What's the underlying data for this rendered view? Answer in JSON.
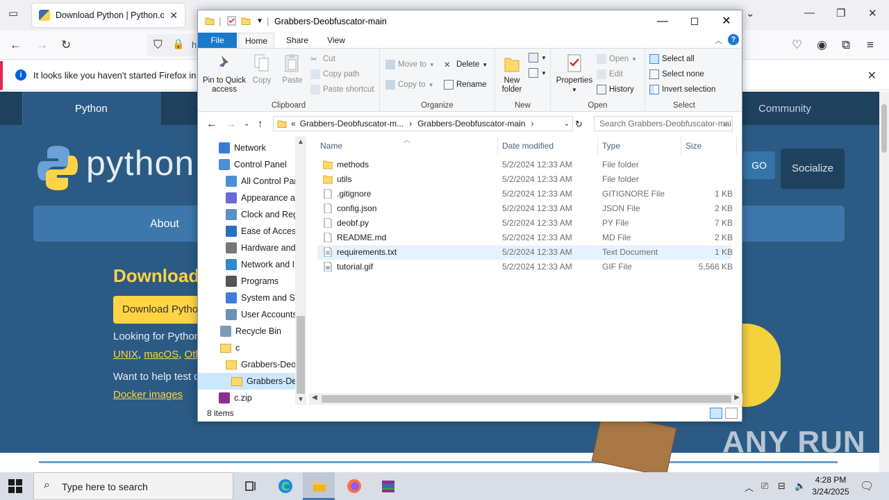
{
  "browser": {
    "tab_title": "Download Python | Python.org",
    "url_prefix": "h",
    "notice": "It looks like you haven't started Firefox in a while"
  },
  "website": {
    "nav": [
      "Python",
      "Community"
    ],
    "wordmark": "python",
    "go": "GO",
    "socialize": "Socialize",
    "menu_about": "About",
    "heading": "Download",
    "download_button": "Download Python",
    "looking_for": "Looking for Python",
    "os_links": [
      "UNIX",
      "macOS",
      "Other"
    ],
    "want_help": "Want to help test development",
    "docker": "Docker images",
    "watermark": "ANY RUN"
  },
  "explorer": {
    "title": "Grabbers-Deobfuscator-main",
    "tabs": {
      "file": "File",
      "home": "Home",
      "share": "Share",
      "view": "View"
    },
    "ribbon": {
      "clipboard": {
        "label": "Clipboard",
        "pin": "Pin to Quick access",
        "copy": "Copy",
        "paste": "Paste",
        "cut": "Cut",
        "copy_path": "Copy path",
        "paste_shortcut": "Paste shortcut"
      },
      "organize": {
        "label": "Organize",
        "move_to": "Move to",
        "copy_to": "Copy to",
        "delete": "Delete",
        "rename": "Rename"
      },
      "new": {
        "label": "New",
        "new_folder": "New folder"
      },
      "open": {
        "label": "Open",
        "properties": "Properties",
        "open": "Open",
        "edit": "Edit",
        "history": "History"
      },
      "select": {
        "label": "Select",
        "select_all": "Select all",
        "select_none": "Select none",
        "invert": "Invert selection"
      }
    },
    "address": {
      "part1": "Grabbers-Deobfuscator-m...",
      "part2": "Grabbers-Deobfuscator-main"
    },
    "search_placeholder": "Search Grabbers-Deobfuscator-main",
    "nav_items": [
      {
        "label": "Network",
        "icon": "network-icon"
      },
      {
        "label": "Control Panel",
        "icon": "control-panel-icon"
      },
      {
        "label": "All Control Panel Items",
        "icon": "control-panel-icon"
      },
      {
        "label": "Appearance and Personalization",
        "icon": "appearance-icon"
      },
      {
        "label": "Clock and Region",
        "icon": "clock-icon"
      },
      {
        "label": "Ease of Access",
        "icon": "ease-of-access-icon"
      },
      {
        "label": "Hardware and Sound",
        "icon": "hardware-icon"
      },
      {
        "label": "Network and Internet",
        "icon": "network-internet-icon"
      },
      {
        "label": "Programs",
        "icon": "programs-icon"
      },
      {
        "label": "System and Security",
        "icon": "system-security-icon"
      },
      {
        "label": "User Accounts",
        "icon": "user-accounts-icon"
      },
      {
        "label": "Recycle Bin",
        "icon": "recycle-bin-icon"
      },
      {
        "label": "c",
        "icon": "folder-icon"
      },
      {
        "label": "Grabbers-Deobfuscator-main",
        "icon": "folder-icon"
      },
      {
        "label": "Grabbers-Deobfuscator-main",
        "icon": "folder-icon"
      },
      {
        "label": "c.zip",
        "icon": "archive-icon"
      }
    ],
    "columns": {
      "name": "Name",
      "date": "Date modified",
      "type": "Type",
      "size": "Size"
    },
    "files": [
      {
        "name": "methods",
        "date": "5/2/2024 12:33 AM",
        "type": "File folder",
        "size": "",
        "icon": "folder-icon"
      },
      {
        "name": "utils",
        "date": "5/2/2024 12:33 AM",
        "type": "File folder",
        "size": "",
        "icon": "folder-icon"
      },
      {
        "name": ".gitignore",
        "date": "5/2/2024 12:33 AM",
        "type": "GITIGNORE File",
        "size": "1 KB",
        "icon": "file-icon"
      },
      {
        "name": "config.json",
        "date": "5/2/2024 12:33 AM",
        "type": "JSON File",
        "size": "2 KB",
        "icon": "file-icon"
      },
      {
        "name": "deobf.py",
        "date": "5/2/2024 12:33 AM",
        "type": "PY File",
        "size": "7 KB",
        "icon": "file-icon"
      },
      {
        "name": "README.md",
        "date": "5/2/2024 12:33 AM",
        "type": "MD File",
        "size": "2 KB",
        "icon": "file-icon"
      },
      {
        "name": "requirements.txt",
        "date": "5/2/2024 12:33 AM",
        "type": "Text Document",
        "size": "1 KB",
        "icon": "text-file-icon"
      },
      {
        "name": "tutorial.gif",
        "date": "5/2/2024 12:33 AM",
        "type": "GIF File",
        "size": "5,566 KB",
        "icon": "image-file-icon"
      }
    ],
    "status": "8 items"
  },
  "taskbar": {
    "search_placeholder": "Type here to search",
    "time": "4:28 PM",
    "date": "3/24/2025"
  },
  "colors": {
    "accent": "#1979ca",
    "folder": "#ffd86b",
    "python_blue": "#2b5b84",
    "python_yellow": "#ffd343"
  }
}
